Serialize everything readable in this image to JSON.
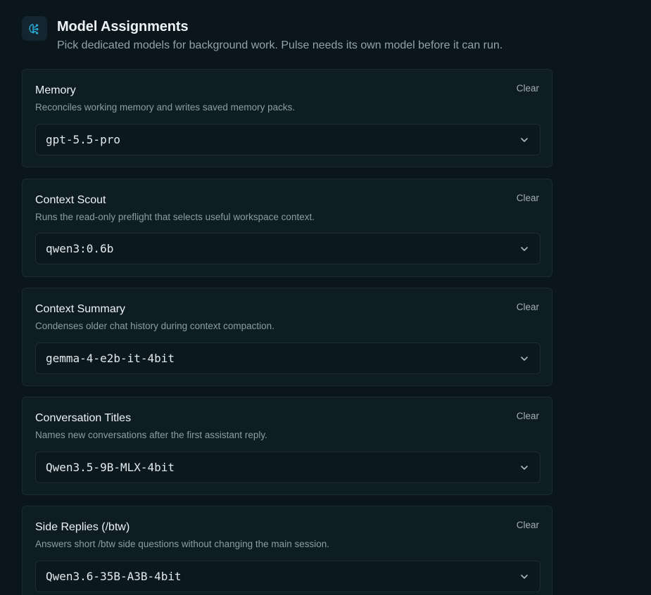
{
  "header": {
    "title": "Model Assignments",
    "subtitle": "Pick dedicated models for background work. Pulse needs its own model before it can run.",
    "icon": "brain-circuit-icon",
    "accent_color": "#27b4e0"
  },
  "assignments": [
    {
      "title": "Memory",
      "description": "Reconciles working memory and writes saved memory packs.",
      "clear_label": "Clear",
      "selected_model": "gpt-5.5-pro"
    },
    {
      "title": "Context Scout",
      "description": "Runs the read-only preflight that selects useful workspace context.",
      "clear_label": "Clear",
      "selected_model": "qwen3:0.6b"
    },
    {
      "title": "Context Summary",
      "description": "Condenses older chat history during context compaction.",
      "clear_label": "Clear",
      "selected_model": "gemma-4-e2b-it-4bit"
    },
    {
      "title": "Conversation Titles",
      "description": "Names new conversations after the first assistant reply.",
      "clear_label": "Clear",
      "selected_model": "Qwen3.5-9B-MLX-4bit"
    },
    {
      "title": "Side Replies (/btw)",
      "description": "Answers short /btw side questions without changing the main session.",
      "clear_label": "Clear",
      "selected_model": "Qwen3.6-35B-A3B-4bit"
    }
  ]
}
